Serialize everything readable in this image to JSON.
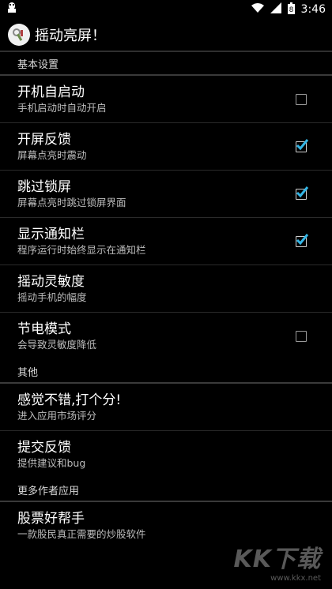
{
  "status": {
    "time": "3:46",
    "battery": "8"
  },
  "app": {
    "title": "摇动亮屏！"
  },
  "groups": [
    {
      "header": "基本设置",
      "items": [
        {
          "title": "开机自启动",
          "summary": "手机启动时自动开启",
          "checked": false
        },
        {
          "title": "开屏反馈",
          "summary": "屏幕点亮时震动",
          "checked": true
        },
        {
          "title": "跳过锁屏",
          "summary": "屏幕点亮时跳过锁屏界面",
          "checked": true
        },
        {
          "title": "显示通知栏",
          "summary": "程序运行时始终显示在通知栏",
          "checked": true
        },
        {
          "title": "摇动灵敏度",
          "summary": "摇动手机的幅度"
        },
        {
          "title": "节电模式",
          "summary": "会导致灵敏度降低",
          "checked": false
        }
      ]
    },
    {
      "header": "其他",
      "items": [
        {
          "title": "感觉不错,打个分!",
          "summary": "进入应用市场评分"
        },
        {
          "title": "提交反馈",
          "summary": "提供建议和bug"
        }
      ]
    },
    {
      "header": "更多作者应用",
      "items": [
        {
          "title": "股票好帮手",
          "summary": "一款股民真正需要的炒股软件"
        }
      ]
    }
  ],
  "watermark": {
    "logo": "KK下载",
    "url": "www.kkx.net"
  },
  "colors": {
    "accent": "#33b5e5"
  }
}
